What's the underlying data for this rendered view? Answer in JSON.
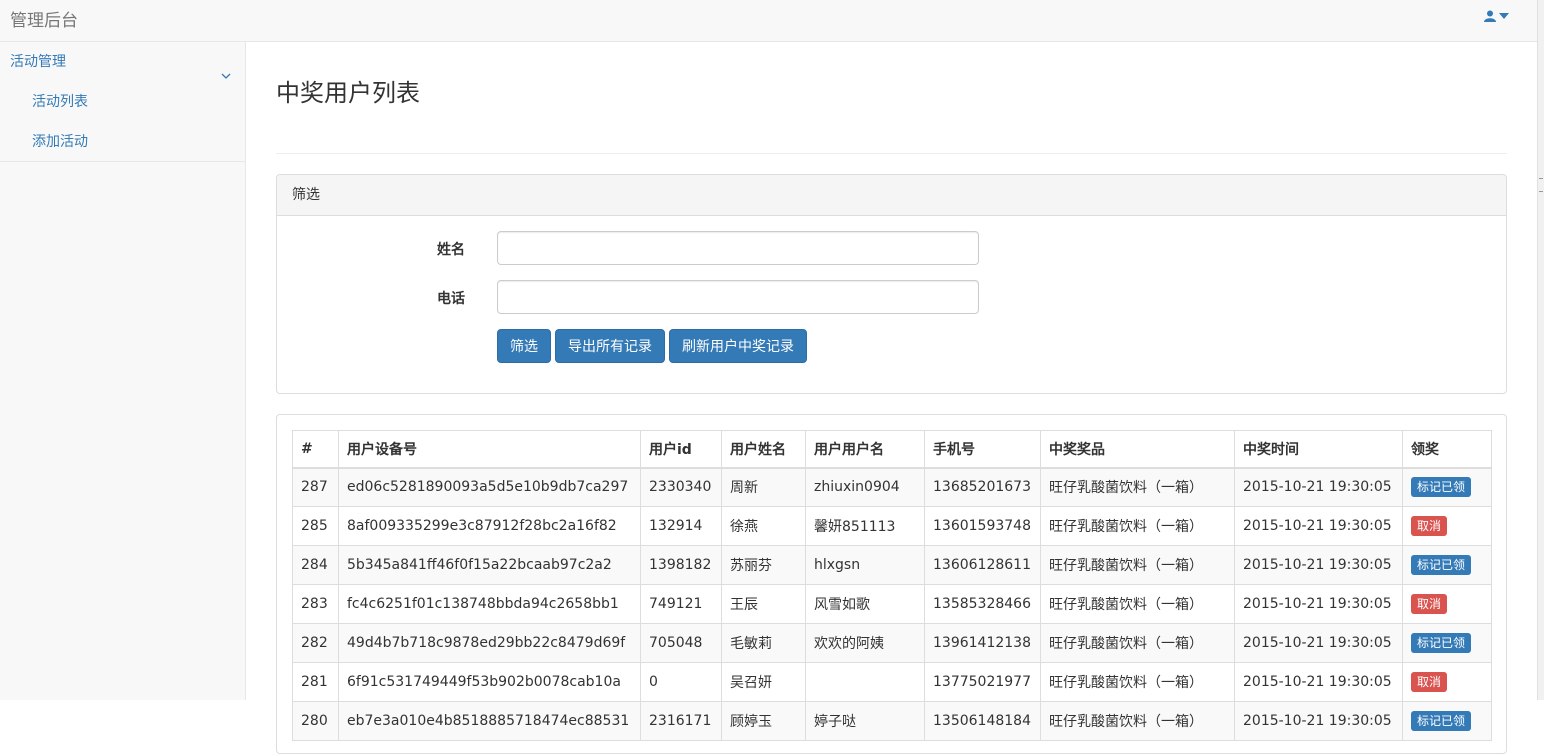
{
  "app": {
    "brand": "管理后台"
  },
  "sidebar": {
    "group_label": "活动管理",
    "items": [
      {
        "label": "活动列表"
      },
      {
        "label": "添加活动"
      }
    ]
  },
  "page": {
    "title": "中奖用户列表"
  },
  "filter": {
    "heading": "筛选",
    "name_label": "姓名",
    "name_value": "",
    "phone_label": "电话",
    "phone_value": "",
    "buttons": {
      "filter": "筛选",
      "export": "导出所有记录",
      "refresh": "刷新用户中奖记录"
    }
  },
  "table": {
    "headers": [
      "#",
      "用户设备号",
      "用户id",
      "用户姓名",
      "用户用户名",
      "手机号",
      "中奖奖品",
      "中奖时间",
      "领奖"
    ],
    "rows": [
      {
        "id": "287",
        "device": "ed06c5281890093a5d5e10b9db7ca297",
        "uid": "2330340",
        "name": "周新",
        "username": "zhiuxin0904",
        "phone": "13685201673",
        "prize": "旺仔乳酸菌饮料（一箱）",
        "time": "2015-10-21 19:30:05",
        "action": "标记已领",
        "action_type": "primary"
      },
      {
        "id": "285",
        "device": "8af009335299e3c87912f28bc2a16f82",
        "uid": "132914",
        "name": "徐燕",
        "username": "馨妍851113",
        "phone": "13601593748",
        "prize": "旺仔乳酸菌饮料（一箱）",
        "time": "2015-10-21 19:30:05",
        "action": "取消",
        "action_type": "danger"
      },
      {
        "id": "284",
        "device": "5b345a841ff46f0f15a22bcaab97c2a2",
        "uid": "1398182",
        "name": "苏丽芬",
        "username": "hlxgsn",
        "phone": "13606128611",
        "prize": "旺仔乳酸菌饮料（一箱）",
        "time": "2015-10-21 19:30:05",
        "action": "标记已领",
        "action_type": "primary"
      },
      {
        "id": "283",
        "device": "fc4c6251f01c138748bbda94c2658bb1",
        "uid": "749121",
        "name": "王辰",
        "username": "风雪如歌",
        "phone": "13585328466",
        "prize": "旺仔乳酸菌饮料（一箱）",
        "time": "2015-10-21 19:30:05",
        "action": "取消",
        "action_type": "danger"
      },
      {
        "id": "282",
        "device": "49d4b7b718c9878ed29bb22c8479d69f",
        "uid": "705048",
        "name": "毛敏莉",
        "username": "欢欢的阿姨",
        "phone": "13961412138",
        "prize": "旺仔乳酸菌饮料（一箱）",
        "time": "2015-10-21 19:30:05",
        "action": "标记已领",
        "action_type": "primary"
      },
      {
        "id": "281",
        "device": "6f91c531749449f53b902b0078cab10a",
        "uid": "0",
        "name": "吴召妍",
        "username": "",
        "phone": "13775021977",
        "prize": "旺仔乳酸菌饮料（一箱）",
        "time": "2015-10-21 19:30:05",
        "action": "取消",
        "action_type": "danger"
      },
      {
        "id": "280",
        "device": "eb7e3a010e4b8518885718474ec88531",
        "uid": "2316171",
        "name": "顾婷玉",
        "username": "婷子哒",
        "phone": "13506148184",
        "prize": "旺仔乳酸菌饮料（一箱）",
        "time": "2015-10-21 19:30:05",
        "action": "标记已领",
        "action_type": "primary"
      }
    ]
  },
  "colors": {
    "primary": "#337ab7",
    "danger": "#d9534f",
    "navbar_bg": "#f8f8f8"
  }
}
